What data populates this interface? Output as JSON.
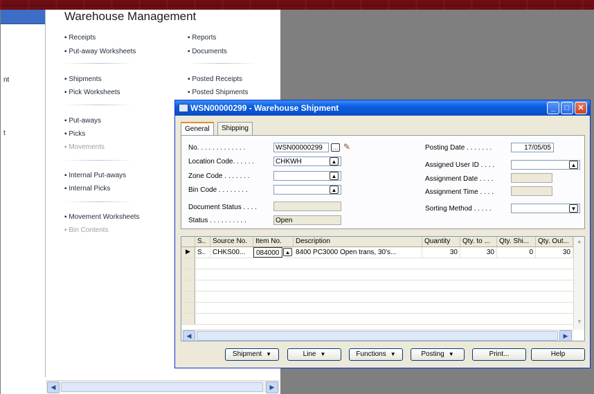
{
  "menu": {
    "title": "Warehouse Management",
    "left_fragments": [
      "nt",
      "t"
    ],
    "col1": [
      {
        "label": "Receipts",
        "dim": false
      },
      {
        "label": "Put-away Worksheets",
        "dim": false
      },
      {
        "label": "Shipments",
        "dim": false
      },
      {
        "label": "Pick Worksheets",
        "dim": false
      },
      {
        "label": "Put-aways",
        "dim": false
      },
      {
        "label": "Picks",
        "dim": false
      },
      {
        "label": "Movements",
        "dim": true
      },
      {
        "label": "Internal Put-aways",
        "dim": false
      },
      {
        "label": "Internal Picks",
        "dim": false
      },
      {
        "label": "Movement Worksheets",
        "dim": false
      },
      {
        "label": "Bin Contents",
        "dim": true
      }
    ],
    "col2": [
      {
        "label": "Reports",
        "dim": false
      },
      {
        "label": "Documents",
        "dim": false
      },
      {
        "label": "Posted Receipts",
        "dim": false
      },
      {
        "label": "Posted Shipments",
        "dim": false
      }
    ]
  },
  "dialog": {
    "title": "WSN00000299 - Warehouse Shipment",
    "tabs": [
      "General",
      "Shipping"
    ],
    "fields": {
      "no_label": "No. . . . . . . . . . . . .",
      "no_value": "WSN00000299",
      "location_label": "Location Code. . . . . .",
      "location_value": "CHKWH",
      "zone_label": "Zone Code . . . . . . .",
      "zone_value": "",
      "bin_label": "Bin Code . . . . . . . .",
      "bin_value": "",
      "docstatus_label": "Document Status . . . .",
      "docstatus_value": "",
      "status_label": "Status . . . . . . . . . .",
      "status_value": "Open",
      "posting_label": "Posting Date . . . . . . .",
      "posting_value": "17/05/05",
      "user_label": "Assigned User ID . . . .",
      "user_value": "",
      "adate_label": "Assignment Date . . . .",
      "adate_value": "",
      "atime_label": "Assignment Time . . . .",
      "atime_value": "",
      "sort_label": "Sorting Method . . . . .",
      "sort_value": ""
    },
    "grid": {
      "headers": [
        "S..",
        "Source No.",
        "Item No.",
        "Description",
        "Quantity",
        "Qty. to ...",
        "Qty. Shi...",
        "Qty. Out..."
      ],
      "row": [
        "S..",
        "CHKS00...",
        "084000",
        "8400 PC3000 Open trans, 30's...",
        "30",
        "30",
        "0",
        "30"
      ]
    },
    "buttons": {
      "shipment": "Shipment",
      "line": "Line",
      "functions": "Functions",
      "posting": "Posting",
      "print": "Print...",
      "help": "Help"
    }
  }
}
